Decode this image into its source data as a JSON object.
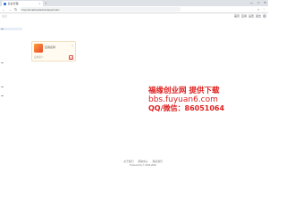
{
  "browser": {
    "tab_title": "后台管理",
    "tab_close": "×",
    "new_tab": "+",
    "win_controls": [
      "—",
      "□",
      "✕"
    ],
    "nav": [
      "←",
      "→",
      "↻"
    ],
    "url": "http://localhost/admin/app/index",
    "addr_icons": [
      "☆",
      "⋮"
    ]
  },
  "header": {
    "logo": "后台",
    "links": [
      "首页",
      "应用",
      "设置",
      "退出"
    ]
  },
  "app_card": {
    "title": "应用名称",
    "close": "×",
    "meta": "应用简介",
    "action_icon": "⚙"
  },
  "watermark": {
    "line1": "福缘创业网  提供下载",
    "line2": "bbs.fuyuan6.com",
    "line3": "QQ/微信：86051064"
  },
  "footer": {
    "links": [
      "关于我们",
      "帮助中心",
      "联系我们"
    ],
    "copyright": "Powered by  © 2018-2020"
  }
}
